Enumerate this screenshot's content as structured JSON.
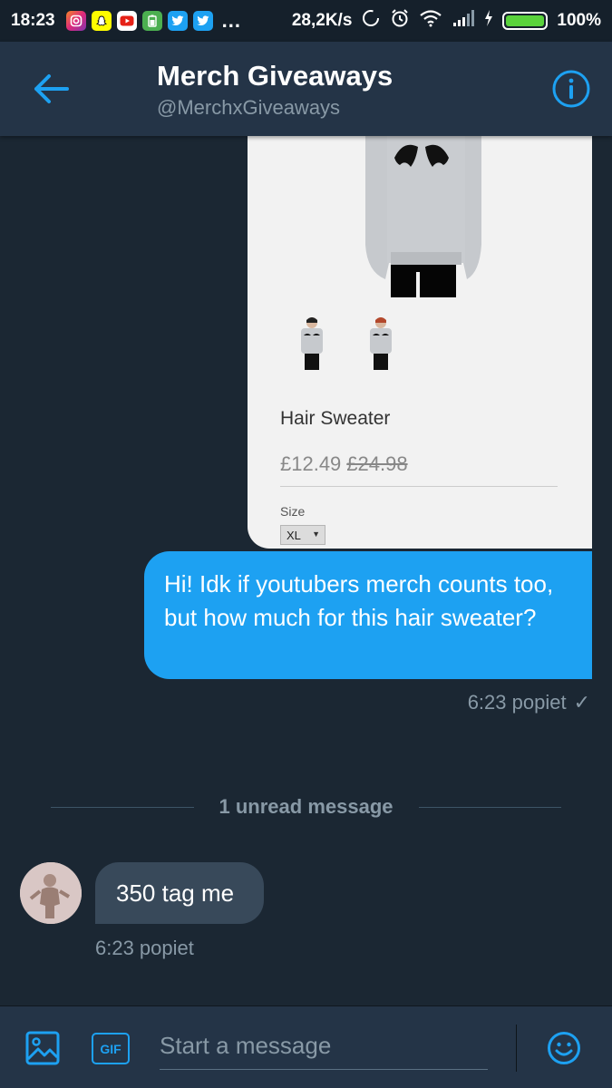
{
  "status_bar": {
    "time": "18:23",
    "network_speed": "28,2K/s",
    "battery_percent": "100%",
    "app_icons": [
      "instagram-icon",
      "snapchat-icon",
      "youtube-icon",
      "battery-app-icon",
      "twitter-icon",
      "twitter-icon"
    ],
    "more": "..."
  },
  "header": {
    "title": "Merch Giveaways",
    "handle": "@MerchxGiveaways"
  },
  "product": {
    "name": "Hair Sweater",
    "price": "£12.49",
    "old_price": "£24.98",
    "size_label": "Size",
    "size_value": "XL",
    "size_arrow": "▼"
  },
  "outgoing": {
    "text": "Hi! Idk if youtubers merch counts too, but how much for this hair sweater?",
    "time": "6:23 popiet",
    "status_icon": "✓"
  },
  "divider": {
    "text": "1 unread message"
  },
  "incoming": {
    "text": "350 tag me",
    "time": "6:23 popiet"
  },
  "composer": {
    "placeholder": "Start a message",
    "gif_label": "GIF"
  },
  "colors": {
    "background": "#1b2733",
    "header": "#243447",
    "accent": "#1da1f2",
    "incoming_bubble": "#38495a",
    "muted_text": "#8899a6"
  }
}
